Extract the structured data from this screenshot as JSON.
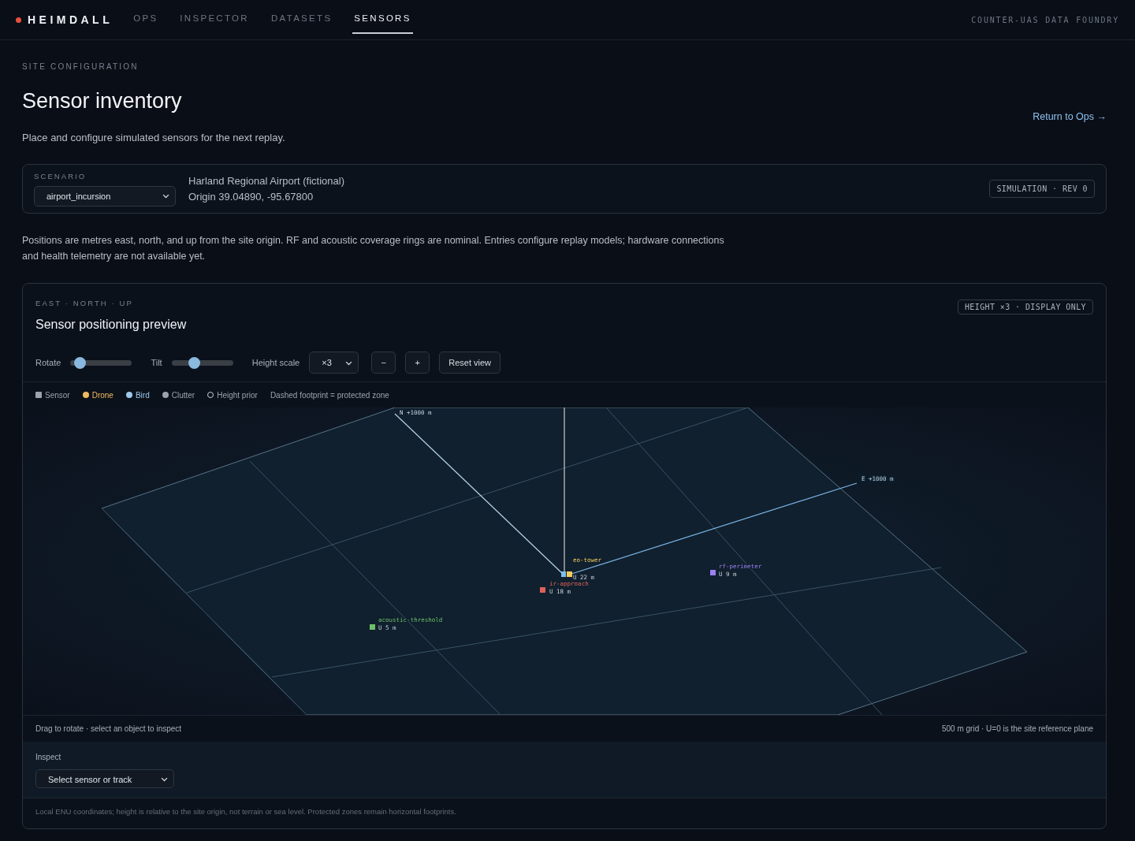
{
  "brand": "HEIMDALL",
  "nav": [
    {
      "label": "OPS",
      "selected": false
    },
    {
      "label": "INSPECTOR",
      "selected": false
    },
    {
      "label": "DATASETS",
      "selected": false
    },
    {
      "label": "SENSORS",
      "selected": true
    }
  ],
  "tagline": "COUNTER-UAS DATA FOUNDRY",
  "header": {
    "eyebrow": "SITE CONFIGURATION",
    "title": "Sensor inventory",
    "subtitle": "Place and configure simulated sensors for the next replay.",
    "return_link": "Return to Ops →"
  },
  "scenario": {
    "label": "SCENARIO",
    "value": "airport_incursion",
    "site": "Harland Regional Airport (fictional)",
    "origin": "Origin 39.04890, -95.67800",
    "badge": "SIMULATION · REV 0"
  },
  "note": "Positions are metres east, north, and up from the site origin. RF and acoustic coverage rings are nominal. Entries configure replay models; hardware connections and health telemetry are not available yet.",
  "preview": {
    "eyebrow": "EAST · NORTH · UP",
    "title": "Sensor positioning preview",
    "badge": "HEIGHT ×3 · DISPLAY ONLY",
    "controls": [
      {
        "kind": "slider",
        "label": "Rotate"
      },
      {
        "kind": "slider",
        "label": "Tilt"
      },
      {
        "kind": "select",
        "label": "Height scale",
        "value": "×3"
      },
      {
        "kind": "button",
        "label": "−"
      },
      {
        "kind": "button",
        "label": "+"
      },
      {
        "kind": "button",
        "label": "Reset view"
      }
    ],
    "legend": [
      {
        "kind": "square",
        "label": "Sensor"
      },
      {
        "kind": "dot",
        "label": "Drone",
        "color": "#f0b860"
      },
      {
        "kind": "dot",
        "label": "Bird",
        "color": "#9cc8f0"
      },
      {
        "kind": "dot",
        "label": "Clutter",
        "color": "#9aa3ae"
      },
      {
        "kind": "ring",
        "label": "Height prior"
      },
      {
        "kind": "text",
        "label": "Dashed footprint = protected zone"
      }
    ],
    "axes": {
      "north": "N +1000 m",
      "east": "E +1000 m"
    },
    "sensors": [
      {
        "name": "eo-tower",
        "height": "U 22 m",
        "color": "#f2cc5a"
      },
      {
        "name": "ir-approach",
        "height": "U 18 m",
        "color": "#e0605a"
      },
      {
        "name": "rf-perimeter",
        "height": "U 9 m",
        "color": "#9a80f0"
      },
      {
        "name": "acoustic-threshold",
        "height": "U 5 m",
        "color": "#6fbf6a"
      }
    ],
    "footer_left": "Drag to rotate · select an object to inspect",
    "footer_right": "500 m grid · U=0 is the site reference plane",
    "inspect_label": "Inspect",
    "inspect_value": "Select sensor or track",
    "footnote": "Local ENU coordinates; height is relative to the site origin, not terrain or sea level. Protected zones remain horizontal footprints."
  }
}
